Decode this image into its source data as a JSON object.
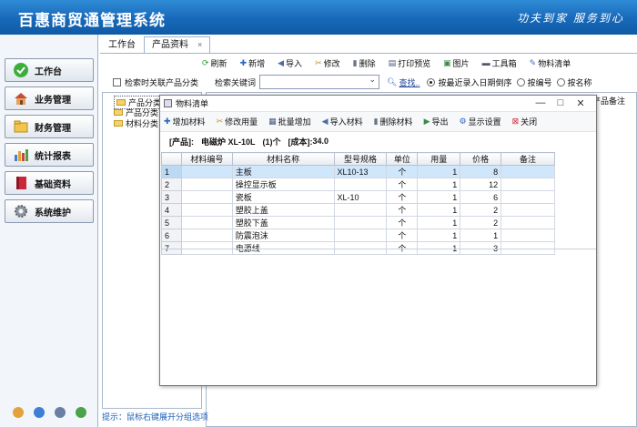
{
  "app": {
    "title": "百惠商贸通管理系统",
    "slogan": "功夫到家 服务到心"
  },
  "sidebar": {
    "items": [
      {
        "label": "工作台",
        "icon": "check-circle-icon"
      },
      {
        "label": "业务管理",
        "icon": "home-icon"
      },
      {
        "label": "财务管理",
        "icon": "folder-icon"
      },
      {
        "label": "统计报表",
        "icon": "bar-chart-icon"
      },
      {
        "label": "基础资料",
        "icon": "book-icon"
      },
      {
        "label": "系统维护",
        "icon": "gear-icon"
      }
    ]
  },
  "tabs": [
    {
      "label": "工作台"
    },
    {
      "label": "产品资料",
      "close": "×"
    }
  ],
  "toolbar": [
    {
      "label": "刷新",
      "icon": "refresh-icon"
    },
    {
      "label": "新增",
      "icon": "add-icon"
    },
    {
      "label": "导入",
      "icon": "import-icon"
    },
    {
      "label": "修改",
      "icon": "edit-icon"
    },
    {
      "label": "删除",
      "icon": "delete-icon"
    },
    {
      "label": "打印预览",
      "icon": "print-icon"
    },
    {
      "label": "图片",
      "icon": "image-icon"
    },
    {
      "label": "工具箱",
      "icon": "toolbox-icon"
    },
    {
      "label": "物料清单",
      "icon": "bom-icon"
    }
  ],
  "search": {
    "checkbox_label": "检索时关联产品分类",
    "keyword_label": "检索关键词",
    "keyword_value": "",
    "find_label": "查找..",
    "sort_options": [
      "按最近录入日期倒序",
      "按编号",
      "按名称"
    ],
    "sort_selected": 0
  },
  "tree": {
    "items": [
      "产品分类表",
      "产品分类",
      "材料分类"
    ]
  },
  "right_header": "产品备注",
  "hint": "提示：鼠标右键展开分组选项",
  "dialog": {
    "title": "物料清单",
    "controls": {
      "minimize": "—",
      "maximize": "□",
      "close": "✕"
    },
    "toolbar": [
      {
        "label": "增加材料",
        "icon": "add-icon"
      },
      {
        "label": "修改用量",
        "icon": "edit-icon"
      },
      {
        "label": "批量增加",
        "icon": "batch-add-icon"
      },
      {
        "label": "导入材料",
        "icon": "import-icon"
      },
      {
        "label": "删除材料",
        "icon": "delete-icon"
      },
      {
        "label": "导出",
        "icon": "export-icon"
      },
      {
        "label": "显示设置",
        "icon": "settings-icon"
      },
      {
        "label": "关闭",
        "icon": "close-icon"
      }
    ],
    "product_label": "[产品]:",
    "product_value": "电磁炉 XL-10L",
    "count_value": "(1)个",
    "cost_label": "[成本]:",
    "cost_value": "34.0",
    "columns": [
      "材料编号",
      "材料名称",
      "型号规格",
      "单位",
      "用量",
      "价格",
      "备注"
    ],
    "rows": [
      {
        "n": "1",
        "code": "",
        "name": "主板",
        "spec": "XL10-13",
        "unit": "个",
        "qty": "1",
        "price": "8",
        "note": ""
      },
      {
        "n": "2",
        "code": "",
        "name": "操控显示板",
        "spec": "",
        "unit": "个",
        "qty": "1",
        "price": "12",
        "note": ""
      },
      {
        "n": "3",
        "code": "",
        "name": "瓷板",
        "spec": "XL-10",
        "unit": "个",
        "qty": "1",
        "price": "6",
        "note": ""
      },
      {
        "n": "4",
        "code": "",
        "name": "塑胶上盖",
        "spec": "",
        "unit": "个",
        "qty": "1",
        "price": "2",
        "note": ""
      },
      {
        "n": "5",
        "code": "",
        "name": "塑胶下盖",
        "spec": "",
        "unit": "个",
        "qty": "1",
        "price": "2",
        "note": ""
      },
      {
        "n": "6",
        "code": "",
        "name": "防震泡沫",
        "spec": "",
        "unit": "个",
        "qty": "1",
        "price": "1",
        "note": ""
      },
      {
        "n": "7",
        "code": "",
        "name": "电源线",
        "spec": "",
        "unit": "个",
        "qty": "1",
        "price": "3",
        "note": ""
      }
    ],
    "selected_row": 0
  }
}
